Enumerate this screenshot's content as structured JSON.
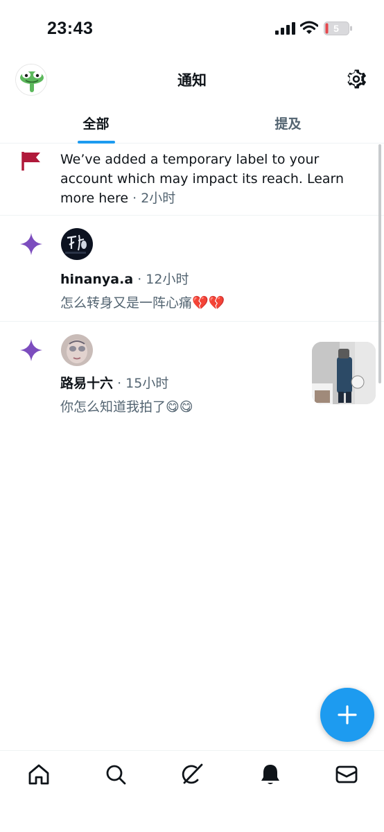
{
  "status_bar": {
    "time": "23:43",
    "battery_level": "5"
  },
  "header": {
    "title": "通知"
  },
  "tabs": [
    {
      "label": "全部",
      "active": true
    },
    {
      "label": "提及",
      "active": false
    }
  ],
  "notifications": [
    {
      "type": "account-label",
      "icon": "flag-icon",
      "text": "We’ve added a temporary label to your account which may impact its reach. Learn more here",
      "time": "· 2小时"
    },
    {
      "type": "recommended-post",
      "icon": "sparkle-icon",
      "user": "hinanya.a",
      "time": "· 12小时",
      "text": "怎么转身又是一阵心痛💔💔"
    },
    {
      "type": "recommended-post",
      "icon": "sparkle-icon",
      "user": "路易十六",
      "time": "· 15小时",
      "text": "你怎么知道我拍了😋😋"
    }
  ],
  "colors": {
    "accent": "#1d9bf0",
    "flag": "#b0193a",
    "sparkle": "#7c4dbe",
    "secondary_text": "#536471"
  },
  "bottom_nav": [
    "home-icon",
    "search-icon",
    "grok-icon",
    "notifications-icon",
    "messages-icon"
  ]
}
